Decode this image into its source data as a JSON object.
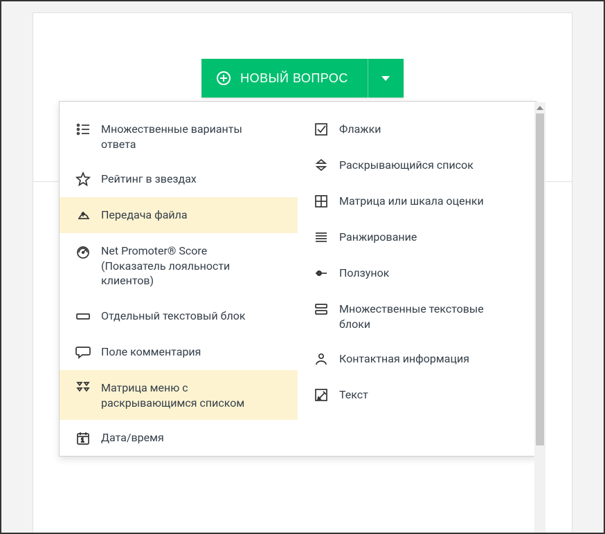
{
  "accent_color": "#00bf6f",
  "button": {
    "label": "НОВЫЙ ВОПРОС"
  },
  "menu": {
    "left": [
      {
        "id": "multiple-choice",
        "label": "Множественные варианты ответа",
        "highlight": false
      },
      {
        "id": "star-rating",
        "label": "Рейтинг в звездах",
        "highlight": false
      },
      {
        "id": "file-upload",
        "label": "Передача файла",
        "highlight": true
      },
      {
        "id": "nps",
        "label": "Net Promoter® Score (Показатель лояльности клиентов)",
        "highlight": false
      },
      {
        "id": "single-textbox",
        "label": "Отдельный текстовый блок",
        "highlight": false
      },
      {
        "id": "comment-box",
        "label": "Поле комментария",
        "highlight": false
      },
      {
        "id": "matrix-dropdown",
        "label": "Матрица меню с раскрывающимся списком",
        "highlight": true
      },
      {
        "id": "date-time",
        "label": "Дата/время",
        "highlight": false
      }
    ],
    "right": [
      {
        "id": "checkboxes",
        "label": "Флажки",
        "highlight": false
      },
      {
        "id": "dropdown",
        "label": "Раскрывающийся список",
        "highlight": false
      },
      {
        "id": "matrix-rating",
        "label": "Матрица или шкала оценки",
        "highlight": false
      },
      {
        "id": "ranking",
        "label": "Ранжирование",
        "highlight": false
      },
      {
        "id": "slider",
        "label": "Ползунок",
        "highlight": false
      },
      {
        "id": "multi-textbox",
        "label": "Множественные текстовые блоки",
        "highlight": false
      },
      {
        "id": "contact-info",
        "label": "Контактная информация",
        "highlight": false
      },
      {
        "id": "text",
        "label": "Текст",
        "highlight": false
      }
    ]
  }
}
